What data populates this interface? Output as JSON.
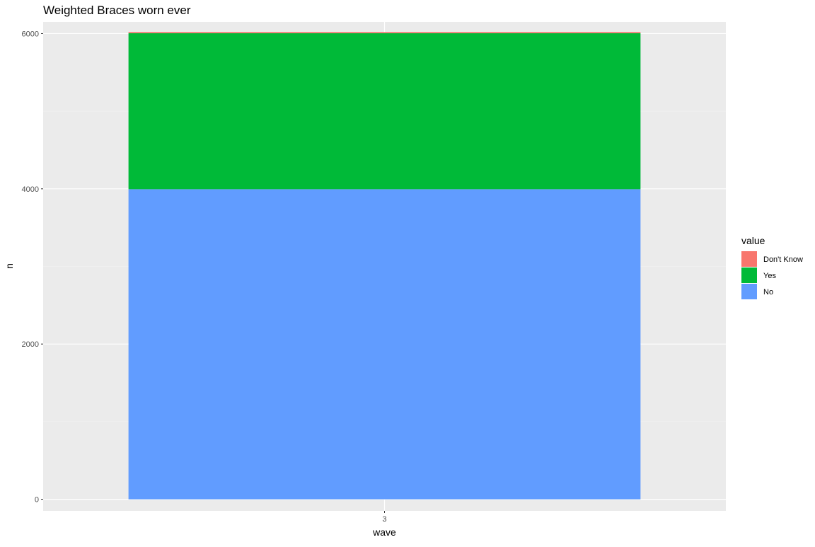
{
  "chart_data": {
    "type": "bar",
    "stacked": true,
    "title": "Weighted  Braces worn ever",
    "xlabel": "wave",
    "ylabel": "n",
    "categories": [
      "3"
    ],
    "ylim": [
      -150,
      6150
    ],
    "yticks": [
      0,
      2000,
      4000,
      6000
    ],
    "grid": true,
    "legend": {
      "title": "value",
      "position": "right",
      "entries": [
        "Don't Know",
        "Yes",
        "No"
      ]
    },
    "series": [
      {
        "name": "No",
        "values": [
          3995
        ],
        "color": "#619CFF"
      },
      {
        "name": "Yes",
        "values": [
          2010
        ],
        "color": "#00BA38"
      },
      {
        "name": "Don't Know",
        "values": [
          15
        ],
        "color": "#F8766D"
      }
    ]
  }
}
